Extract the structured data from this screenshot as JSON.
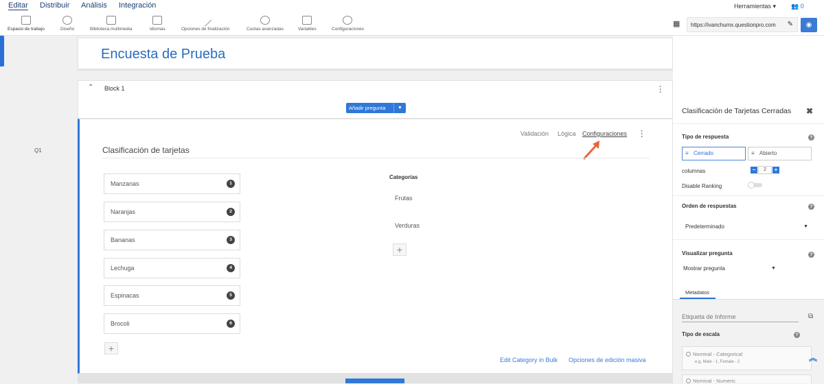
{
  "top_nav": {
    "items": [
      "Editar",
      "Distribuir",
      "Análisis",
      "Integración"
    ],
    "tools_label": "Herramientas",
    "user_count": "0"
  },
  "toolbar": {
    "items": [
      {
        "label": "Espacio de trabajo",
        "icon": "workspace-icon"
      },
      {
        "label": "Diseño",
        "icon": "palette-icon"
      },
      {
        "label": "Biblioteca multimedia",
        "icon": "image-icon"
      },
      {
        "label": "Idiomas",
        "icon": "language-icon"
      },
      {
        "label": "Opciones de finalización",
        "icon": "magic-wand-icon"
      },
      {
        "label": "Cuotas avanzadas",
        "icon": "quota-icon"
      },
      {
        "label": "Variables",
        "icon": "tag-icon"
      },
      {
        "label": "Configuraciones",
        "icon": "gear-icon"
      }
    ],
    "url": "https://ivanchumx.questionpro.com"
  },
  "survey": {
    "title": "Encuesta de Prueba",
    "block_title": "Block 1",
    "add_question_label": "Añadir pregunta"
  },
  "question": {
    "label": "Q1",
    "title": "Clasificación de tarjetas",
    "tabs": [
      "Validación",
      "Lógica",
      "Configuraciones"
    ],
    "items": [
      {
        "text": "Manzanas",
        "num": "1"
      },
      {
        "text": "Naranjas",
        "num": "2"
      },
      {
        "text": "Bananas",
        "num": "3"
      },
      {
        "text": "Lechuga",
        "num": "4"
      },
      {
        "text": "Espinacas",
        "num": "5"
      },
      {
        "text": "Brocoli",
        "num": "6"
      }
    ],
    "categories_header": "Categorías",
    "categories": [
      "Frutas",
      "Verduras"
    ],
    "links": {
      "bulk": "Edit Category in Bulk",
      "mass": "Opciones de edición masiva"
    }
  },
  "right_panel": {
    "title": "Clasificación de Tarjetas Cerradas",
    "response_type_label": "Tipo de respuesta",
    "closed_label": "Cerrado",
    "open_label": "Abierto",
    "columns_label": "columnas",
    "columns_value": "2",
    "disable_ranking_label": "Disable Ranking",
    "order_label": "Orden de respuestas",
    "order_value": "Predeterminado",
    "display_label": "Visualizar pregunta",
    "display_value": "Mostrar pregunta",
    "metadata_tab": "Metadatos",
    "report_tag_placeholder": "Etiqueta de Informe",
    "scale_type_label": "Tipo de escala",
    "scale_options": [
      {
        "label": "Nominal - Categorical",
        "example": "e.g. Male - 1, Female - 2"
      },
      {
        "label": "Nominal - Numeric",
        "example": ""
      }
    ]
  },
  "colors": {
    "accent": "#2f78d8",
    "title": "#2b6bbf",
    "nav": "#1b3f73"
  }
}
